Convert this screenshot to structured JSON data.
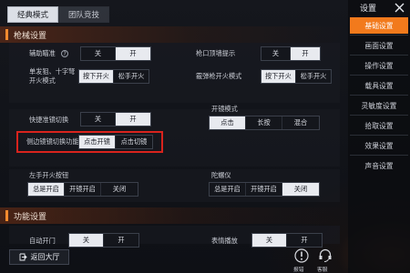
{
  "top_tabs": [
    "经典模式",
    "团队竞技"
  ],
  "sections": {
    "aim_assist": "枪械设置",
    "function": "功能设置"
  },
  "rows": {
    "aim_assist_label": "辅助瞄准",
    "aim_assist_options": [
      "关",
      "开"
    ],
    "muzzle_hint_label": "枪口顶墙提示",
    "muzzle_hint_options": [
      "关",
      "开"
    ],
    "single_shot_label": "单发狙、十字弩开火模式",
    "single_shot_options": [
      "按下开火",
      "松手开火"
    ],
    "bolt_action_label": "霰弹枪开火模式",
    "bolt_action_options": [
      "按下开火",
      "松手开火"
    ],
    "quick_scope_label": "快捷准镜切换",
    "quick_scope_options": [
      "关",
      "开"
    ],
    "scope_mode_label": "开镜模式",
    "scope_mode_options": [
      "点击",
      "长按",
      "混合"
    ],
    "side_scope_label": "侧边镜镜切换功能",
    "side_scope_options": [
      "点击开镜",
      "点击切镜"
    ],
    "left_fire_label": "左手开火按钮",
    "left_fire_options": [
      "总是开启",
      "开镜开启",
      "关闭"
    ],
    "gyro_label": "陀螺仪",
    "gyro_options": [
      "总是开启",
      "开镜开启",
      "关闭"
    ],
    "auto_door_label": "自动开门",
    "auto_door_options": [
      "关",
      "开"
    ],
    "emote_label": "表情播放",
    "emote_options": [
      "关",
      "开"
    ]
  },
  "sidebar": {
    "title": "设置",
    "items": [
      "基础设置",
      "画面设置",
      "操作设置",
      "载具设置",
      "灵敏度设置",
      "拾取设置",
      "效果设置",
      "声音设置"
    ]
  },
  "bottom": {
    "back_label": "返回大厅",
    "icon1_label": "报错",
    "icon2_label": "客服"
  }
}
